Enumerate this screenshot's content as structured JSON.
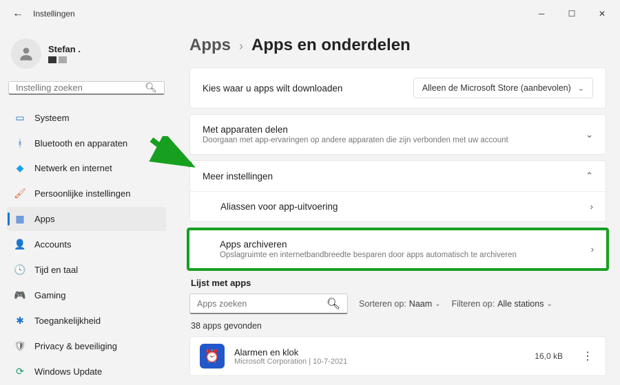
{
  "window": {
    "title": "Instellingen"
  },
  "user": {
    "name": "Stefan ."
  },
  "search": {
    "placeholder": "Instelling zoeken"
  },
  "nav": {
    "system": "Systeem",
    "bluetooth": "Bluetooth en apparaten",
    "network": "Netwerk en internet",
    "personal": "Persoonlijke instellingen",
    "apps": "Apps",
    "accounts": "Accounts",
    "time": "Tijd en taal",
    "gaming": "Gaming",
    "access": "Toegankelijkheid",
    "privacy": "Privacy & beveiliging",
    "update": "Windows Update"
  },
  "crumb": {
    "root": "Apps",
    "page": "Apps en onderdelen"
  },
  "download": {
    "label": "Kies waar u apps wilt downloaden",
    "value": "Alleen de Microsoft Store (aanbevolen)"
  },
  "share": {
    "title": "Met apparaten delen",
    "sub": "Doorgaan met app-ervaringen op andere apparaten die zijn verbonden met uw account"
  },
  "more": {
    "title": "Meer instellingen",
    "aliases": "Aliassen voor app-uitvoering",
    "archive_title": "Apps archiveren",
    "archive_sub": "Opslagruimte en internetbandbreedte besparen door apps automatisch te archiveren"
  },
  "applist": {
    "heading": "Lijst met apps",
    "search_placeholder": "Apps zoeken",
    "sort_label": "Sorteren op:",
    "sort_value": "Naam",
    "filter_label": "Filteren op:",
    "filter_value": "Alle stations",
    "count": "38 apps gevonden",
    "item1_name": "Alarmen en klok",
    "item1_pub": "Microsoft Corporation",
    "item1_sep": "  |  ",
    "item1_date": "10-7-2021",
    "item1_size": "16,0 kB"
  }
}
